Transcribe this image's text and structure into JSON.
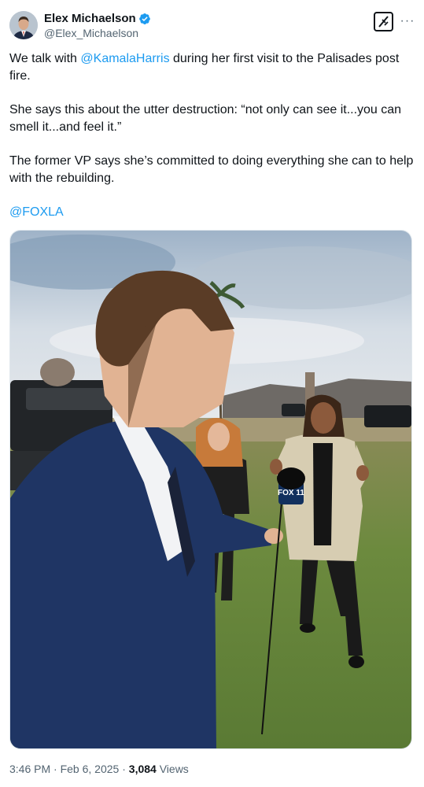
{
  "author": {
    "display_name": "Elex Michaelson",
    "handle": "@Elex_Michaelson",
    "verified": true,
    "avatar_icon": "profile-avatar"
  },
  "actions": {
    "grok_icon": "grok-icon",
    "more_icon": "more-icon",
    "more_label": "···"
  },
  "tweet": {
    "p1_prefix": "We talk with ",
    "p1_mention": "@KamalaHarris",
    "p1_suffix": " during her first visit to the Palisades post fire.",
    "p2": "She says this about the utter destruction: “not only can see it...you can smell it...and feel it.”",
    "p3": "The former VP says she’s committed to doing everything she can to help with the rebuilding.",
    "p4_mention": "@FOXLA"
  },
  "media": {
    "mic_flag_text": "FOX 11"
  },
  "meta": {
    "time": "3:46 PM",
    "sep1": " · ",
    "date": "Feb 6, 2025",
    "sep2": " · ",
    "views_count": "3,084",
    "views_label": " Views"
  },
  "colors": {
    "link": "#1d9bf0",
    "verified": "#1d9bf0",
    "secondary_text": "#536471",
    "primary_text": "#0f1419"
  }
}
